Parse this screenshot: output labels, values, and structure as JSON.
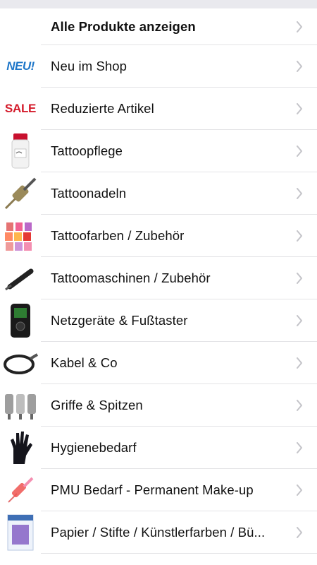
{
  "list": {
    "items": [
      {
        "label": "Alle Produkte anzeigen",
        "icon": null
      },
      {
        "label": "Neu im Shop",
        "icon": "neu-logo",
        "icon_text": "NEU!"
      },
      {
        "label": "Reduzierte Artikel",
        "icon": "sale-logo",
        "icon_text": "SALE"
      },
      {
        "label": "Tattoopflege",
        "icon": "cream-jar-icon"
      },
      {
        "label": "Tattoonadeln",
        "icon": "needle-cartridge-icon"
      },
      {
        "label": "Tattoofarben / Zubehör",
        "icon": "ink-bottles-icon"
      },
      {
        "label": "Tattoomaschinen / Zubehör",
        "icon": "tattoo-pen-icon"
      },
      {
        "label": "Netzgeräte & Fußtaster",
        "icon": "power-supply-icon"
      },
      {
        "label": "Kabel & Co",
        "icon": "cable-icon"
      },
      {
        "label": "Griffe & Spitzen",
        "icon": "grips-icon"
      },
      {
        "label": "Hygienebedarf",
        "icon": "glove-icon"
      },
      {
        "label": "PMU Bedarf - Permanent Make-up",
        "icon": "pmu-needle-icon"
      },
      {
        "label": "Papier / Stifte / Künstlerfarben / Bü...",
        "icon": "paper-pad-icon"
      }
    ]
  },
  "colors": {
    "separator": "#e3e3e6",
    "chevron": "#c4c4c9",
    "topbar": "#e9e9ee"
  }
}
